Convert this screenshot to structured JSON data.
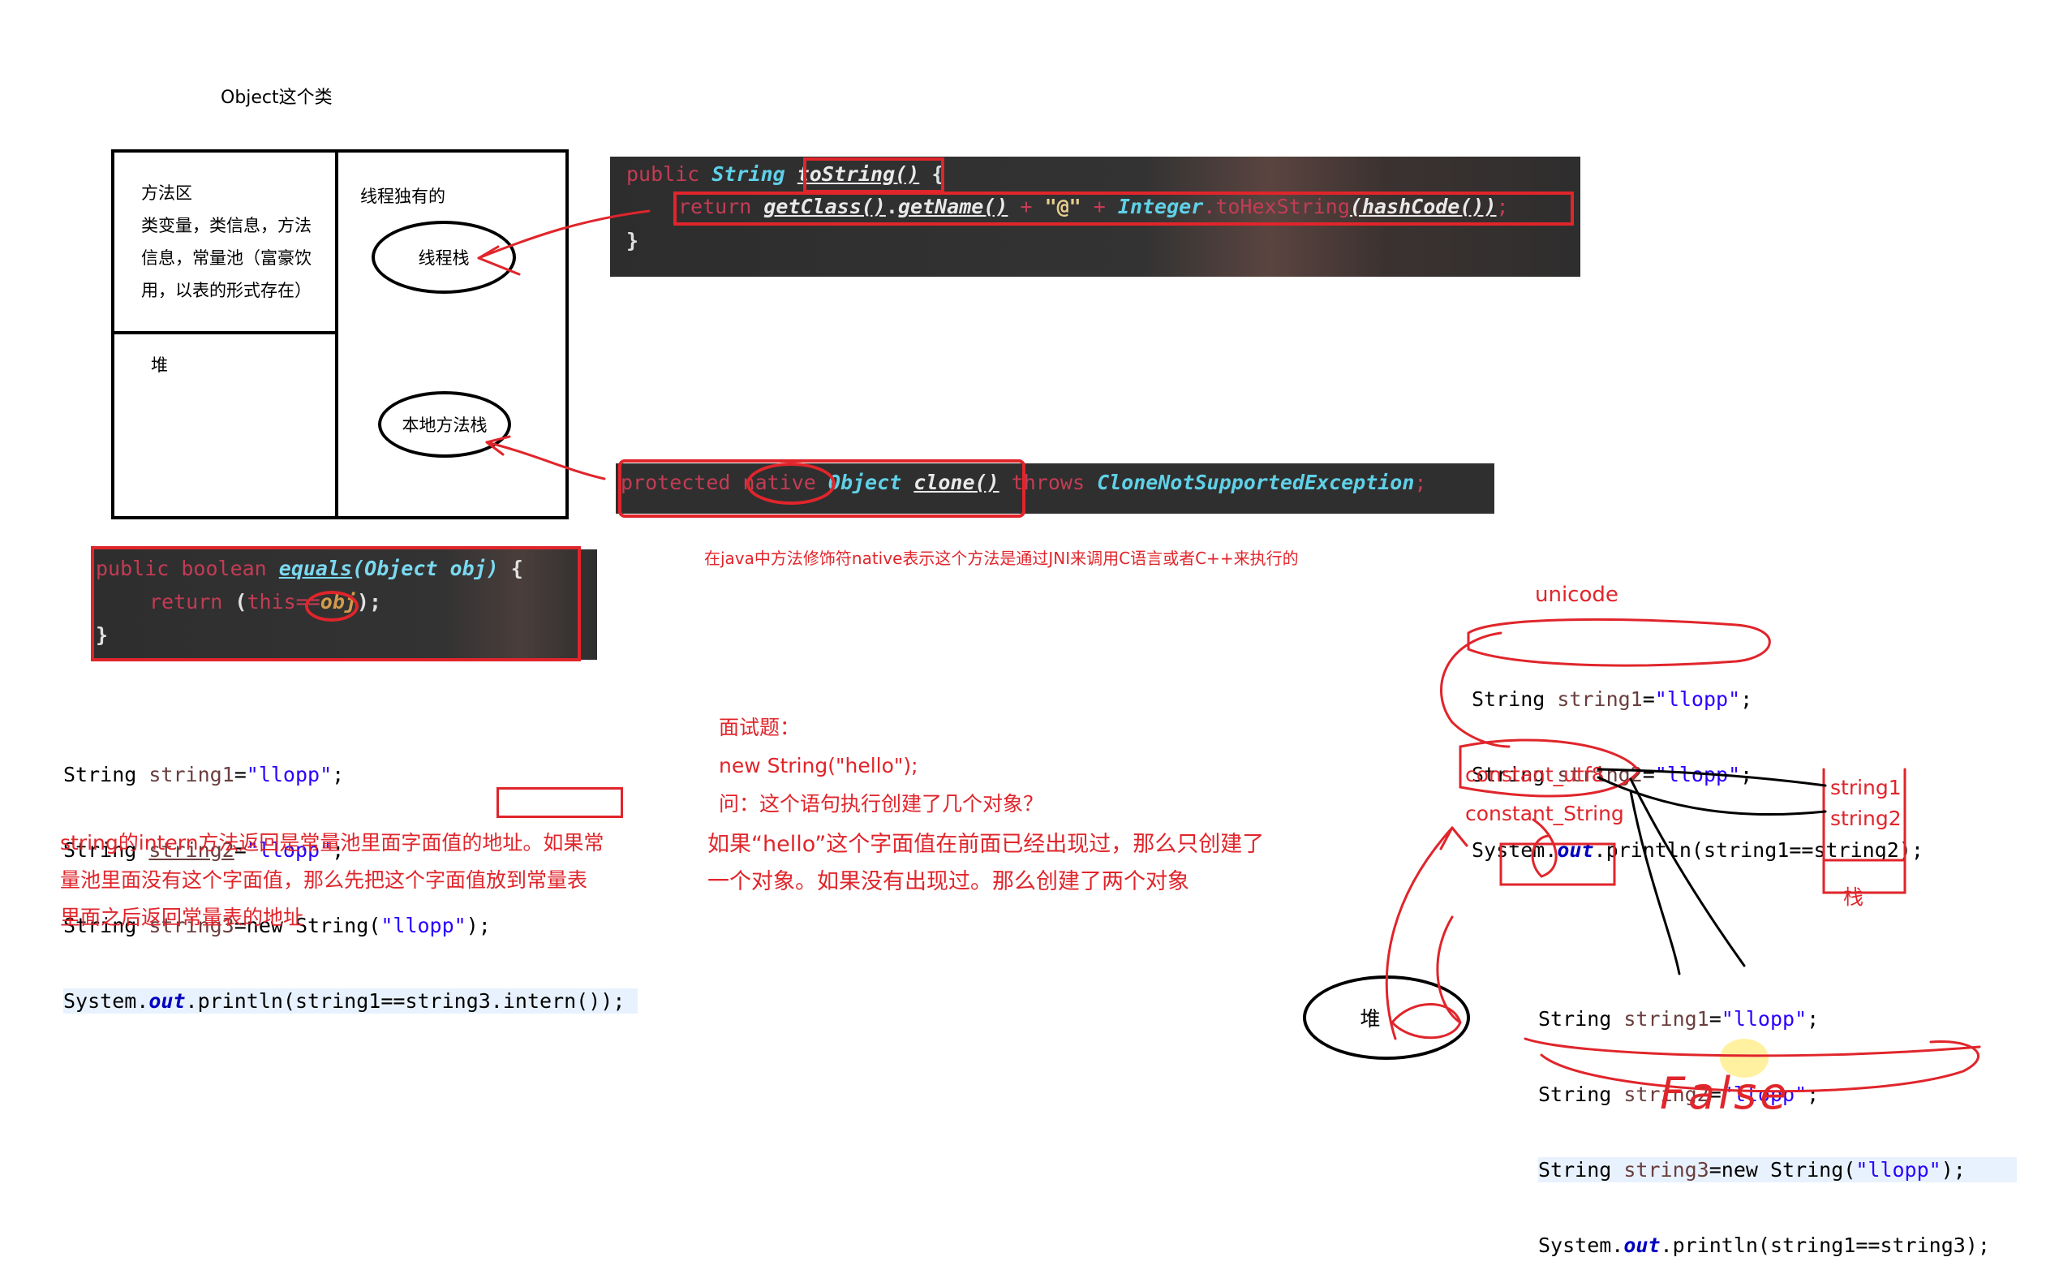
{
  "title": "Object这个类",
  "memory": {
    "method_area": {
      "heading": "方法区",
      "lines": [
        "类变量，类信息，方法",
        "信息，常量池（富豪饮",
        "用，以表的形式存在）"
      ]
    },
    "heap": "堆",
    "thread_private": "线程独有的",
    "thread_stack": "线程栈",
    "native_stack": "本地方法栈"
  },
  "tostring_code": {
    "line1": {
      "kw": "public",
      "type": "String",
      "name": "toString()",
      "brace": "{"
    },
    "line2": {
      "kw": "return",
      "call1": "getClass()",
      "dot1": ".",
      "call2": "getName()",
      "plus1": " + ",
      "str": "\"@\"",
      "plus2": " + ",
      "cls": "Integer",
      "dot2": ".",
      "method": "toHexString",
      "arg": "(hashCode())",
      "semi": ";"
    },
    "line3": "}"
  },
  "clone_code": {
    "kw1": "protected",
    "kw2": "native",
    "type": "Object",
    "name": "clone()",
    "kw3": "throws",
    "exc": "CloneNotSupportedException",
    "semi": ";"
  },
  "native_note": "在java中方法修饰符native表示这个方法是通过JNI来调用C语言或者C++来执行的",
  "equals_code": {
    "line1": {
      "kw": "public boolean",
      "name": "equals",
      "params": "(Object obj)",
      "brace": " {"
    },
    "line2": {
      "kw": "return",
      "expr_open": "(",
      "this": "this",
      "op": "==",
      "obj": "obj",
      "close": ");"
    },
    "line3": "}"
  },
  "intern_code": {
    "lines": [
      [
        "String ",
        "string1",
        "=",
        "\"llopp\"",
        ";"
      ],
      [
        "String ",
        "string2",
        "=",
        "\"llopp\"",
        ";"
      ],
      [
        "String ",
        "string3",
        "=new String(",
        "\"llopp\"",
        ");"
      ]
    ],
    "println": {
      "prefix": "System.",
      "out": "out",
      "rest": ".println(string1==string3.",
      "call": "intern()",
      "tail": ");"
    }
  },
  "intern_note": [
    "string的intern方法返回是常量池里面字面值的地址。如果常",
    "量池里面没有这个字面值，那么先把这个字面值放到常量表",
    "里面之后返回常量表的地址"
  ],
  "interview": {
    "lines": [
      "面试题：",
      "new String(\"hello\");",
      "问：这个语句执行创建了几个对象？"
    ],
    "answer": [
      "如果“hello”这个字面值在前面已经出现过，那么只创建了",
      "一个对象。如果没有出现过。那么创建了两个对象"
    ]
  },
  "sketch": {
    "unicode": "unicode",
    "code_top": [
      [
        "String ",
        "string1",
        "=",
        "\"llopp\"",
        ";"
      ],
      [
        "String ",
        "string2",
        "=",
        "\"llopp\"",
        ";"
      ]
    ],
    "println_top": {
      "prefix": "System.",
      "out": "out",
      "rest": ".println(string1==string2);"
    },
    "constant_utf8": "constant_utf8",
    "constant_string": "constant_String",
    "string1": "string1",
    "string2": "string2",
    "stack": "栈",
    "heap": "堆",
    "code_bottom": [
      [
        "String ",
        "string1",
        "=",
        "\"llopp\"",
        ";"
      ],
      [
        "String ",
        "string2",
        "=",
        "\"llopp\"",
        ";"
      ],
      [
        "String ",
        "string3",
        "=new String(",
        "\"llopp\"",
        ");"
      ]
    ],
    "println_bottom": {
      "prefix": "System.",
      "out": "out",
      "rest": ".println(string1==string3);"
    },
    "result": "False"
  }
}
